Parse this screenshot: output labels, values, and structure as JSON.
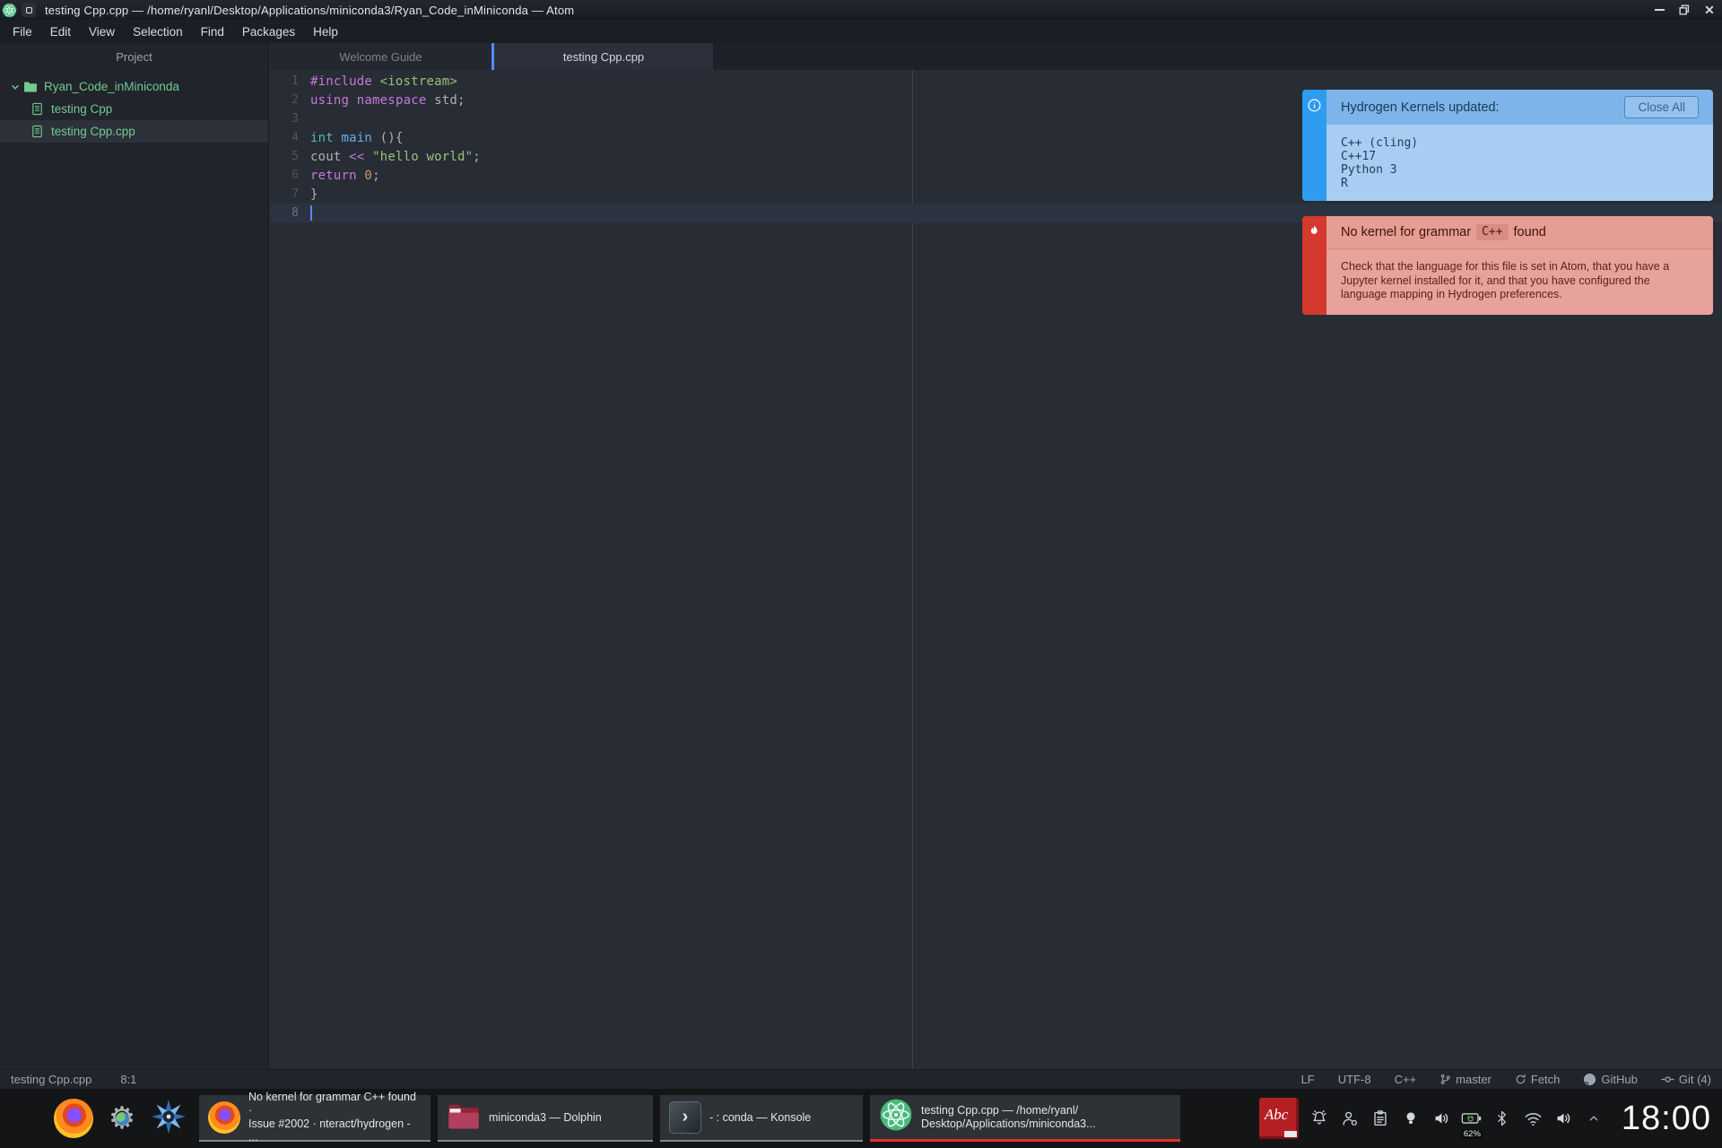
{
  "window": {
    "title": "testing Cpp.cpp — /home/ryanl/Desktop/Applications/miniconda3/Ryan_Code_inMiniconda — Atom",
    "controls": [
      "minimize",
      "maximize",
      "close"
    ]
  },
  "menu": {
    "items": [
      "File",
      "Edit",
      "View",
      "Selection",
      "Find",
      "Packages",
      "Help"
    ]
  },
  "tree": {
    "header": "Project",
    "items": [
      {
        "label": "Ryan_Code_inMiniconda",
        "type": "folder",
        "expanded": true,
        "selected": false
      },
      {
        "label": "testing Cpp",
        "type": "file",
        "selected": false
      },
      {
        "label": "testing Cpp.cpp",
        "type": "file",
        "selected": true
      }
    ]
  },
  "tabs": [
    {
      "label": "Welcome Guide",
      "active": false
    },
    {
      "label": "testing Cpp.cpp",
      "active": true
    }
  ],
  "editor": {
    "lines": [
      {
        "n": 1,
        "tokens": [
          [
            "#include",
            "kw"
          ],
          [
            " ",
            "pl"
          ],
          [
            "<iostream>",
            "str"
          ]
        ]
      },
      {
        "n": 2,
        "tokens": [
          [
            "using",
            "kw"
          ],
          [
            " ",
            "pl"
          ],
          [
            "namespace",
            "kw"
          ],
          [
            " std;",
            "pl"
          ]
        ]
      },
      {
        "n": 3,
        "tokens": []
      },
      {
        "n": 4,
        "tokens": [
          [
            "int",
            "ty"
          ],
          [
            " ",
            "pl"
          ],
          [
            "main",
            "fn"
          ],
          [
            " (){",
            "pl"
          ]
        ]
      },
      {
        "n": 5,
        "tokens": [
          [
            "cout",
            "pl"
          ],
          [
            " ",
            "pl"
          ],
          [
            "<<",
            "kw"
          ],
          [
            " ",
            "pl"
          ],
          [
            "\"hello world\"",
            "str"
          ],
          [
            ";",
            "pl"
          ]
        ]
      },
      {
        "n": 6,
        "tokens": [
          [
            "return",
            "kw"
          ],
          [
            " ",
            "pl"
          ],
          [
            "0",
            "num"
          ],
          [
            ";",
            "pl"
          ]
        ]
      },
      {
        "n": 7,
        "tokens": [
          [
            "}",
            "pl"
          ]
        ]
      },
      {
        "n": 8,
        "tokens": [],
        "cursor": true,
        "active": true
      }
    ]
  },
  "notifications": {
    "info": {
      "icon": "info-icon",
      "title": "Hydrogen Kernels updated:",
      "button": "Close All",
      "lines": [
        "C++ (cling)",
        "C++17",
        "Python 3",
        "R"
      ]
    },
    "error": {
      "icon": "flame-icon",
      "title_pre": "No kernel for grammar",
      "code": "C++",
      "title_post": "found",
      "body": "Check that the language for this file is set in Atom, that you have a Jupyter kernel installed for it, and that you have configured the language mapping in Hydrogen preferences."
    }
  },
  "statusbar": {
    "file": "testing Cpp.cpp",
    "position": "8:1",
    "right": [
      {
        "label": "LF"
      },
      {
        "label": "UTF-8"
      },
      {
        "label": "C++"
      },
      {
        "label": "master",
        "icon": "branch"
      },
      {
        "label": "Fetch",
        "icon": "sync"
      },
      {
        "label": "GitHub",
        "icon": "github"
      },
      {
        "label": "Git (4)",
        "icon": "commit"
      }
    ]
  },
  "taskbar": {
    "launchers": [
      "firefox",
      "settings",
      "compass"
    ],
    "tasks": [
      {
        "icon": "firefox",
        "lines": [
          "No kernel for grammar C++ found ·",
          "Issue #2002 · nteract/hydrogen - ..."
        ],
        "attention": false
      },
      {
        "icon": "dolphin",
        "lines": [
          "miniconda3 — Dolphin"
        ],
        "attention": false
      },
      {
        "icon": "konsole",
        "lines": [
          "- : conda — Konsole"
        ],
        "attention": false
      },
      {
        "icon": "atom",
        "lines": [
          "testing Cpp.cpp — /home/ryanl/",
          "Desktop/Applications/miniconda3..."
        ],
        "attention": true
      }
    ],
    "tray": {
      "icons": [
        "dictionary",
        "bell",
        "user",
        "clipboard",
        "bulb",
        "volume",
        "battery",
        "bluetooth",
        "wifi",
        "volume2",
        "chevron-up"
      ],
      "battery_percent": "62%",
      "clock": "18:00"
    }
  },
  "colors": {
    "accent_blue": "#508cf9",
    "cursor_blue": "#528bff",
    "git_added_green": "#73c990",
    "info_notification_blue": "#2d9bf0",
    "error_notification_red": "#d3392d",
    "attention_red": "#e8312a",
    "editor_bg": "#282c34",
    "panel_bg": "#21252b",
    "syntax_keyword": "#c678dd",
    "syntax_string": "#98c379",
    "syntax_type": "#56b6c2",
    "syntax_function": "#61afef",
    "syntax_number": "#d19a66"
  }
}
